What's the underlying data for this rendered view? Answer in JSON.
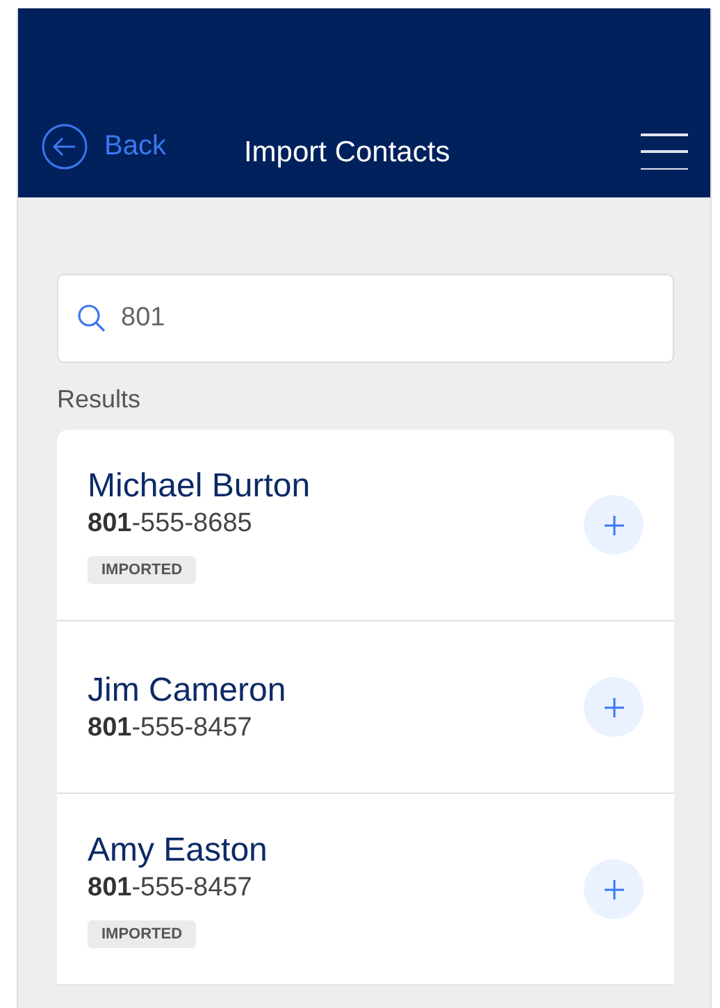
{
  "header": {
    "back_label": "Back",
    "title": "Import Contacts"
  },
  "search": {
    "value": "801"
  },
  "results_label": "Results",
  "contacts": [
    {
      "name": "Michael Burton",
      "phone": "**801**-555-8685",
      "badge": "IMPORTED"
    },
    {
      "name": "Jim Cameron",
      "phone": "**801**-555-8457"
    },
    {
      "name": "Amy Easton",
      "phone": "**801**-555-8457",
      "badge": "IMPORTED"
    }
  ]
}
